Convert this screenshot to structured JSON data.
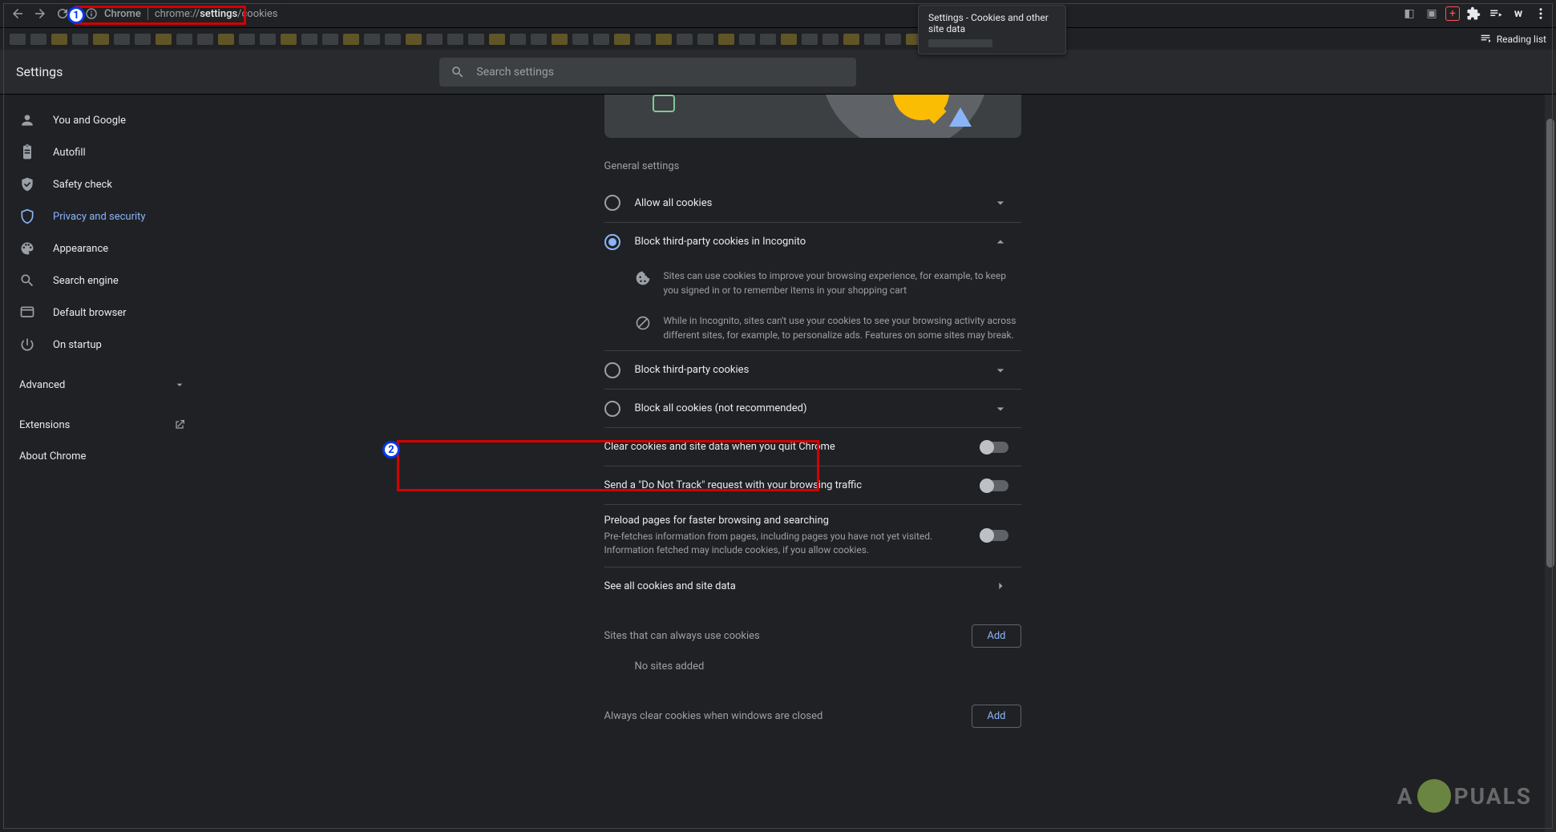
{
  "chrome": {
    "label": "Chrome",
    "url_faded": "chrome://",
    "url_bold": "settings",
    "url_tail": "/cookies",
    "reading_list": "Reading list",
    "tooltip_title": "Settings - Cookies and other site data"
  },
  "header": {
    "title": "Settings",
    "search_placeholder": "Search settings"
  },
  "sidebar": {
    "items": [
      {
        "label": "You and Google"
      },
      {
        "label": "Autofill"
      },
      {
        "label": "Safety check"
      },
      {
        "label": "Privacy and security"
      },
      {
        "label": "Appearance"
      },
      {
        "label": "Search engine"
      },
      {
        "label": "Default browser"
      },
      {
        "label": "On startup"
      }
    ],
    "advanced": "Advanced",
    "extensions": "Extensions",
    "about": "About Chrome"
  },
  "content": {
    "general_label": "General settings",
    "opt_allow_all": "Allow all cookies",
    "opt_block_incog": "Block third-party cookies in Incognito",
    "detail1": "Sites can use cookies to improve your browsing experience, for example, to keep you signed in or to remember items in your shopping cart",
    "detail2": "While in Incognito, sites can't use your cookies to see your browsing activity across different sites, for example, to personalize ads. Features on some sites may break.",
    "opt_block_third": "Block third-party cookies",
    "opt_block_all": "Block all cookies (not recommended)",
    "clear_quit": "Clear cookies and site data when you quit Chrome",
    "dnt": "Send a \"Do Not Track\" request with your browsing traffic",
    "preload_title": "Preload pages for faster browsing and searching",
    "preload_sub": "Pre-fetches information from pages, including pages you have not yet visited. Information fetched may include cookies, if you allow cookies.",
    "see_all": "See all cookies and site data",
    "sites_always": "Sites that can always use cookies",
    "no_sites": "No sites added",
    "always_clear": "Always clear cookies when windows are closed",
    "add_btn": "Add"
  },
  "annotations": {
    "one": "1",
    "two": "2"
  },
  "watermark": {
    "pre": "A",
    "post": "PUALS"
  }
}
